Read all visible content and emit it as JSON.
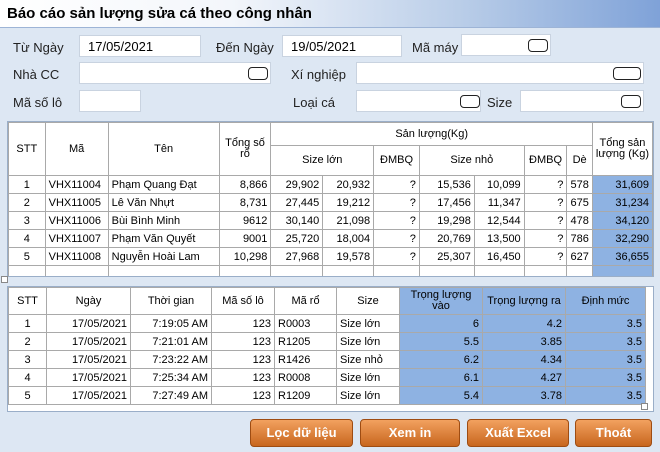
{
  "title": "Báo cáo sản lượng sửa cá theo công nhân",
  "filters": {
    "tu_ngay_label": "Từ Ngày",
    "tu_ngay_value": "17/05/2021",
    "den_ngay_label": "Đến Ngày",
    "den_ngay_value": "19/05/2021",
    "ma_may_label": "Mã máy",
    "ma_may_value": "",
    "nha_cc_label": "Nhà CC",
    "nha_cc_value": "",
    "xi_nghiep_label": "Xí nghiệp",
    "xi_nghiep_value": "",
    "ma_so_lo_label": "Mã số lô",
    "ma_so_lo_value": "",
    "loai_ca_label": "Loại cá",
    "loai_ca_value": "",
    "size_label": "Size",
    "size_value": ""
  },
  "summary_table": {
    "headers": {
      "stt": "STT",
      "ma": "Mã",
      "ten": "Tên",
      "tong_so_ro": "Tổng số rổ",
      "san_luong": "Sản lượng(Kg)",
      "size_lon": "Size lớn",
      "dmbq1": "ĐMBQ",
      "size_nho": "Size nhỏ",
      "dmbq2": "ĐMBQ",
      "de": "Dè",
      "tong_san_luong": "Tổng sản lượng (Kg)"
    },
    "rows": [
      {
        "stt": "1",
        "ma": "VHX11004",
        "ten": "Phạm Quang Đạt",
        "tong_so_ro": "8,866",
        "sl1": "29,902",
        "sl2": "20,932",
        "dmbq1": "?",
        "sn1": "15,536",
        "sn2": "10,099",
        "dmbq2": "?",
        "de": "578",
        "tong": "31,609"
      },
      {
        "stt": "2",
        "ma": "VHX11005",
        "ten": "Lê Văn Nhựt",
        "tong_so_ro": "8,731",
        "sl1": "27,445",
        "sl2": "19,212",
        "dmbq1": "?",
        "sn1": "17,456",
        "sn2": "11,347",
        "dmbq2": "?",
        "de": "675",
        "tong": "31,234"
      },
      {
        "stt": "3",
        "ma": "VHX11006",
        "ten": "Bùi Bình Minh",
        "tong_so_ro": "9612",
        "sl1": "30,140",
        "sl2": "21,098",
        "dmbq1": "?",
        "sn1": "19,298",
        "sn2": "12,544",
        "dmbq2": "?",
        "de": "478",
        "tong": "34,120"
      },
      {
        "stt": "4",
        "ma": "VHX11007",
        "ten": "Phạm Văn Quyết",
        "tong_so_ro": "9001",
        "sl1": "25,720",
        "sl2": "18,004",
        "dmbq1": "?",
        "sn1": "20,769",
        "sn2": "13,500",
        "dmbq2": "?",
        "de": "786",
        "tong": "32,290"
      },
      {
        "stt": "5",
        "ma": "VHX11008",
        "ten": "Nguyễn Hoài Lam",
        "tong_so_ro": "10,298",
        "sl1": "27,968",
        "sl2": "19,578",
        "dmbq1": "?",
        "sn1": "25,307",
        "sn2": "16,450",
        "dmbq2": "?",
        "de": "627",
        "tong": "36,655"
      }
    ],
    "ellipsis_row": "..."
  },
  "detail_table": {
    "headers": {
      "stt": "STT",
      "ngay": "Ngày",
      "thoi_gian": "Thời gian",
      "ma_so_lo": "Mã số lô",
      "ma_ro": "Mã rổ",
      "size": "Size",
      "trong_luong_vao": "Trọng lượng vào",
      "trong_luong_ra": "Trọng lượng ra",
      "dinh_muc": "Định mức"
    },
    "rows": [
      {
        "stt": "1",
        "ngay": "17/05/2021",
        "thoi_gian": "7:19:05 AM",
        "ma_so_lo": "123",
        "ma_ro": "R0003",
        "size": "Size lớn",
        "vao": "6",
        "ra": "4.2",
        "dinh_muc": "3.5"
      },
      {
        "stt": "2",
        "ngay": "17/05/2021",
        "thoi_gian": "7:21:01 AM",
        "ma_so_lo": "123",
        "ma_ro": "R1205",
        "size": "Size lớn",
        "vao": "5.5",
        "ra": "3.85",
        "dinh_muc": "3.5"
      },
      {
        "stt": "3",
        "ngay": "17/05/2021",
        "thoi_gian": "7:23:22 AM",
        "ma_so_lo": "123",
        "ma_ro": "R1426",
        "size": "Size nhỏ",
        "vao": "6.2",
        "ra": "4.34",
        "dinh_muc": "3.5"
      },
      {
        "stt": "4",
        "ngay": "17/05/2021",
        "thoi_gian": "7:25:34 AM",
        "ma_so_lo": "123",
        "ma_ro": "R0008",
        "size": "Size lớn",
        "vao": "6.1",
        "ra": "4.27",
        "dinh_muc": "3.5"
      },
      {
        "stt": "5",
        "ngay": "17/05/2021",
        "thoi_gian": "7:27:49 AM",
        "ma_so_lo": "123",
        "ma_ro": "R1209",
        "size": "Size lớn",
        "vao": "5.4",
        "ra": "3.78",
        "dinh_muc": "3.5"
      }
    ]
  },
  "buttons": {
    "loc": "Lọc dữ liệu",
    "xem": "Xem in",
    "xuat": "Xuất Excel",
    "thoat": "Thoát"
  },
  "colors": {
    "highlight": "#8eb2e2",
    "button": "#d5772f",
    "background": "#dde7f3"
  }
}
